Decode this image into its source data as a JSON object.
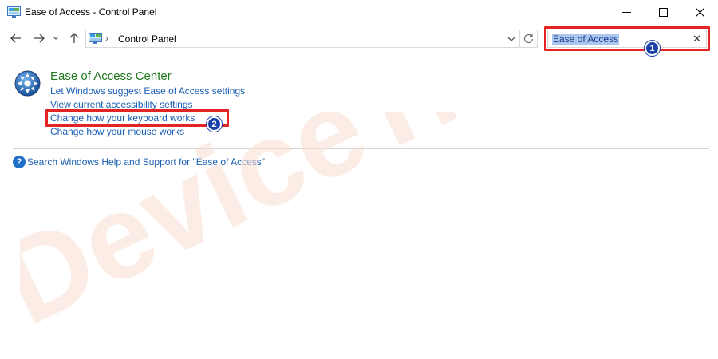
{
  "window": {
    "title": "Ease of Access - Control Panel"
  },
  "nav": {
    "breadcrumb_separator": "›",
    "breadcrumb": "Control Panel"
  },
  "search": {
    "value": "Ease of Access",
    "clear_glyph": "✕"
  },
  "markers": {
    "one": "1",
    "two": "2"
  },
  "content": {
    "section_title": "Ease of Access Center",
    "links": [
      "Let Windows suggest Ease of Access settings",
      "View current accessibility settings",
      "Change how your keyboard works",
      "Change how your mouse works"
    ],
    "help_glyph": "?",
    "help_link": "Search Windows Help and Support for \"Ease of Access\""
  },
  "watermark": {
    "text": "DeviceTricks",
    "color": "#f7dcd0"
  },
  "colors": {
    "link": "#1a5fb4",
    "section_title": "#1e7a1e",
    "highlight": "#e32424",
    "marker": "#1a3fa8"
  }
}
